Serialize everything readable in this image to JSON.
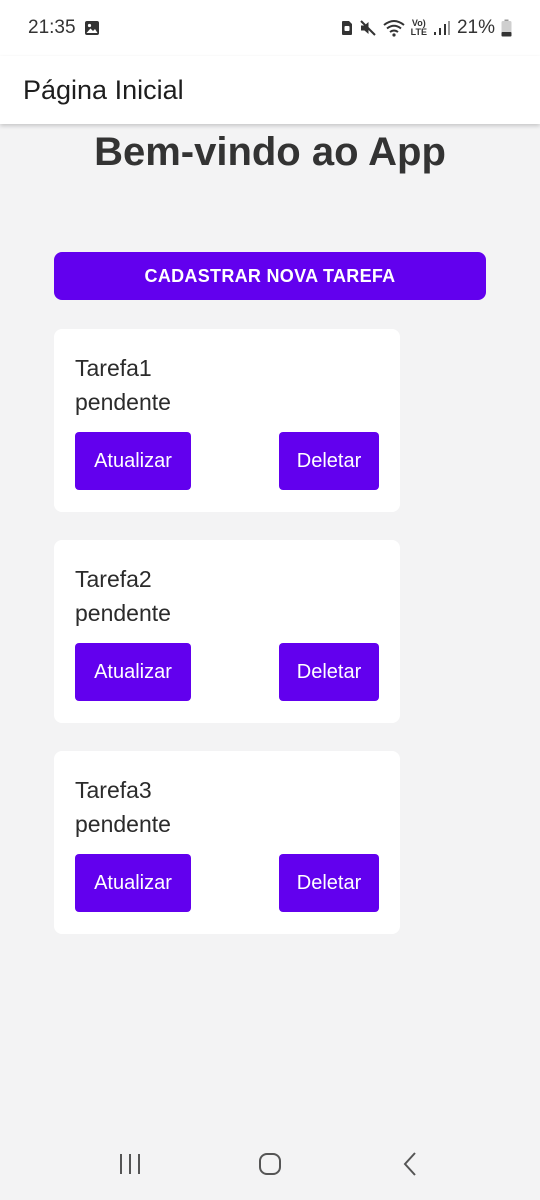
{
  "status_bar": {
    "time": "21:35",
    "lte_top": "Vo)",
    "lte_bottom": "LTE",
    "battery": "21%"
  },
  "app_bar": {
    "title": "Página Inicial"
  },
  "main": {
    "welcome": "Bem-vindo ao App",
    "add_button": "CADASTRAR NOVA TAREFA"
  },
  "tasks": [
    {
      "name": "Tarefa1",
      "status": "pendente",
      "update_label": "Atualizar",
      "delete_label": "Deletar"
    },
    {
      "name": "Tarefa2",
      "status": "pendente",
      "update_label": "Atualizar",
      "delete_label": "Deletar"
    },
    {
      "name": "Tarefa3",
      "status": "pendente",
      "update_label": "Atualizar",
      "delete_label": "Deletar"
    }
  ],
  "icons": {
    "status_left": [
      "image-icon"
    ],
    "status_right": [
      "sim-icon",
      "mute-icon",
      "wifi-icon",
      "volte-icon",
      "signal-icon",
      "battery-icon"
    ],
    "nav": [
      "recents-icon",
      "home-icon",
      "back-icon"
    ]
  },
  "colors": {
    "accent": "#6200ee",
    "background": "#f3f3f4",
    "card": "#ffffff"
  }
}
